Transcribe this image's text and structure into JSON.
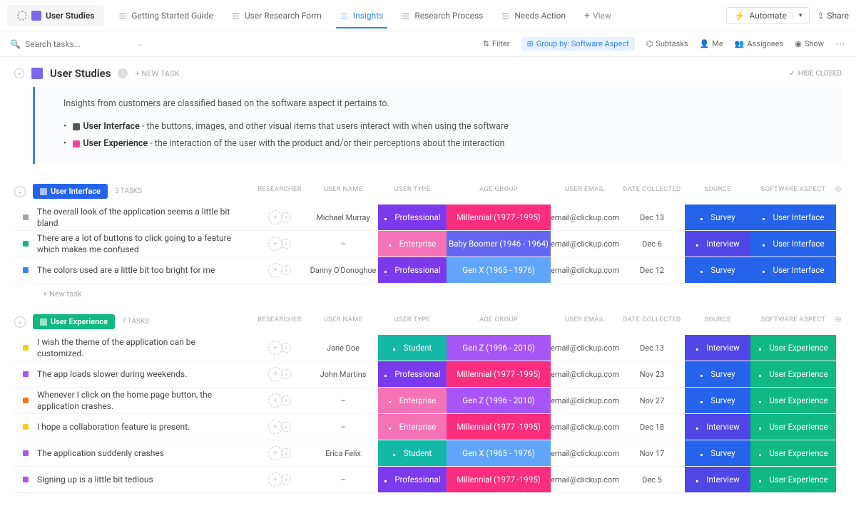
{
  "topbar": {
    "home": "User Studies",
    "tabs": [
      "Getting Started Guide",
      "User Research Form",
      "Insights",
      "Research Process",
      "Needs Action"
    ],
    "active_tab": 2,
    "new_view": "View",
    "automate": "Automate",
    "share": "Share"
  },
  "toolbar": {
    "search_placeholder": "Search tasks...",
    "filter": "Filter",
    "groupby": "Group by: Software Aspect",
    "subtasks": "Subtasks",
    "me": "Me",
    "assignees": "Assignees",
    "show": "Show"
  },
  "page": {
    "title": "User Studies",
    "new_task": "+ NEW TASK",
    "hide_closed": "HIDE CLOSED",
    "desc_intro": "Insights from customers are classified based on the software aspect it pertains to.",
    "bullet1_label": "User Interface",
    "bullet1_text": " - the buttons, images, and other visual items that users interact with when using the software",
    "bullet2_label": "User Experience",
    "bullet2_text": " - the interaction of the user with the product and/or their perceptions about the interaction"
  },
  "columns": {
    "researcher": "RESEARCHER",
    "user_name": "USER NAME",
    "user_type": "USER TYPE",
    "age_group": "AGE GROUP",
    "user_email": "USER EMAIL",
    "date_collected": "DATE COLLECTED",
    "source": "SOURCE",
    "software_aspect": "SOFTWARE ASPECT"
  },
  "groups": [
    {
      "name": "User Interface",
      "count": "3 TASKS",
      "pill_color": "#2563eb",
      "tasks": [
        {
          "sq": "#9ca3af",
          "name": "The overall look of the application seems a little bit bland",
          "user_name": "Michael Murray",
          "user_type": {
            "t": "Professional",
            "c": "c-purple"
          },
          "age_group": {
            "t": "Millennial (1977 -1995)",
            "c": "c-hotpink"
          },
          "email": "email@clickup.com",
          "date": "Dec 13",
          "source": {
            "t": "Survey",
            "c": "c-blue"
          },
          "aspect": {
            "t": "User Interface",
            "c": "c-blue"
          }
        },
        {
          "sq": "#10b981",
          "name": "There are a lot of buttons to click going to a feature which makes me confused",
          "user_name": "–",
          "user_type": {
            "t": "Enterprise",
            "c": "c-pink"
          },
          "age_group": {
            "t": "Baby Boomer (1946 - 1964)",
            "c": "c-indigo"
          },
          "email": "email@clickup.com",
          "date": "Dec 6",
          "source": {
            "t": "Interview",
            "c": "c-royalblue"
          },
          "aspect": {
            "t": "User Interface",
            "c": "c-blue"
          }
        },
        {
          "sq": "#3b82f6",
          "name": "The colors used are a little bit too bright for me",
          "user_name": "Danny O'Donoghue",
          "user_type": {
            "t": "Professional",
            "c": "c-purple"
          },
          "age_group": {
            "t": "Gen X (1965 - 1976)",
            "c": "c-skyblue"
          },
          "email": "email@clickup.com",
          "date": "Dec 12",
          "source": {
            "t": "Survey",
            "c": "c-blue"
          },
          "aspect": {
            "t": "User Interface",
            "c": "c-blue"
          }
        }
      ],
      "new_task": "+ New task"
    },
    {
      "name": "User Experience",
      "count": "7 TASKS",
      "pill_color": "#10b981",
      "tasks": [
        {
          "sq": "#facc15",
          "name": "I wish the theme of the application can be customized.",
          "user_name": "Jane Doe",
          "user_type": {
            "t": "Student",
            "c": "c-teal"
          },
          "age_group": {
            "t": "Gen Z (1996 - 2010)",
            "c": "c-violet"
          },
          "email": "email@clickup.com",
          "date": "Dec 13",
          "source": {
            "t": "Interview",
            "c": "c-royalblue"
          },
          "aspect": {
            "t": "User Experience",
            "c": "c-green"
          }
        },
        {
          "sq": "#a855f7",
          "name": "The app loads slower during weekends.",
          "user_name": "John Martins",
          "user_type": {
            "t": "Professional",
            "c": "c-purple"
          },
          "age_group": {
            "t": "Millennial (1977 -1995)",
            "c": "c-hotpink"
          },
          "email": "email@clickup.com",
          "date": "Nov 23",
          "source": {
            "t": "Survey",
            "c": "c-blue"
          },
          "aspect": {
            "t": "User Experience",
            "c": "c-green"
          }
        },
        {
          "sq": "#f97316",
          "name": "Whenever I click on the home page button, the application crashes.",
          "user_name": "–",
          "user_type": {
            "t": "Enterprise",
            "c": "c-pink"
          },
          "age_group": {
            "t": "Gen Z (1996 - 2010)",
            "c": "c-violet"
          },
          "email": "email@clickup.com",
          "date": "Nov 27",
          "source": {
            "t": "Survey",
            "c": "c-blue"
          },
          "aspect": {
            "t": "User Experience",
            "c": "c-green"
          }
        },
        {
          "sq": "#facc15",
          "name": "I hope a collaboration feature is present.",
          "user_name": "–",
          "user_type": {
            "t": "Enterprise",
            "c": "c-pink"
          },
          "age_group": {
            "t": "Millennial (1977 -1995)",
            "c": "c-hotpink"
          },
          "email": "email@clickup.com",
          "date": "Dec 18",
          "source": {
            "t": "Interview",
            "c": "c-royalblue"
          },
          "aspect": {
            "t": "User Experience",
            "c": "c-green"
          }
        },
        {
          "sq": "#a855f7",
          "name": "The application suddenly crashes",
          "user_name": "Erica Felix",
          "user_type": {
            "t": "Student",
            "c": "c-teal"
          },
          "age_group": {
            "t": "Gen X (1965 - 1976)",
            "c": "c-skyblue"
          },
          "email": "email@clickup.com",
          "date": "Nov 17",
          "source": {
            "t": "Survey",
            "c": "c-blue"
          },
          "aspect": {
            "t": "User Experience",
            "c": "c-green"
          }
        },
        {
          "sq": "#a855f7",
          "name": "Signing up is a little bit tedious",
          "user_name": "–",
          "user_type": {
            "t": "Professional",
            "c": "c-purple"
          },
          "age_group": {
            "t": "Millennial (1977 -1995)",
            "c": "c-hotpink"
          },
          "email": "email@clickup.com",
          "date": "Dec 5",
          "source": {
            "t": "Interview",
            "c": "c-royalblue"
          },
          "aspect": {
            "t": "User Experience",
            "c": "c-green"
          }
        }
      ]
    }
  ]
}
